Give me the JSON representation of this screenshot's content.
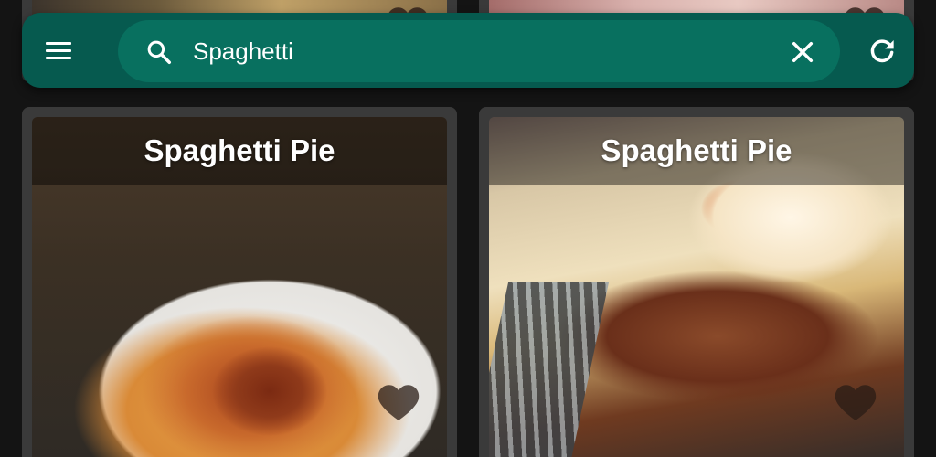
{
  "search": {
    "value": "Spaghetti",
    "icon": "search-icon",
    "clear_icon": "close-icon"
  },
  "toolbar": {
    "menu_icon": "menu-icon",
    "refresh_icon": "refresh-icon",
    "background": "#065a4f",
    "search_background": "#08705f"
  },
  "recipes": [
    {
      "title": "Spaghetti Pie",
      "favorite_icon": "heart-icon"
    },
    {
      "title": "Spaghetti Pie",
      "favorite_icon": "heart-icon"
    }
  ]
}
